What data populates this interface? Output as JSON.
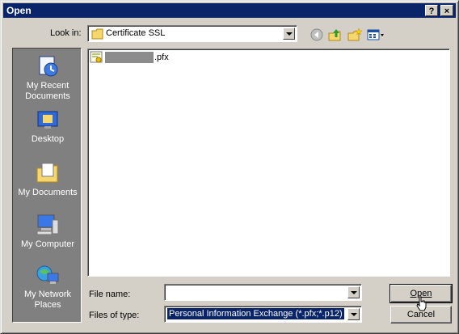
{
  "window": {
    "title": "Open"
  },
  "title_buttons": {
    "help": "?",
    "close": "×"
  },
  "look_in": {
    "label": "Look in:",
    "value": "Certificate SSL"
  },
  "toolbar_icons": [
    "back-icon",
    "up-folder-icon",
    "new-folder-icon",
    "view-menu-icon"
  ],
  "places": [
    {
      "label": "My Recent Documents",
      "icon": "recent-documents-icon"
    },
    {
      "label": "Desktop",
      "icon": "desktop-icon"
    },
    {
      "label": "My Documents",
      "icon": "my-documents-icon"
    },
    {
      "label": "My Computer",
      "icon": "my-computer-icon"
    },
    {
      "label": "My Network Places",
      "icon": "network-places-icon"
    }
  ],
  "files": [
    {
      "name_suffix": ".pfx",
      "icon": "certificate-file-icon"
    }
  ],
  "file_name": {
    "label": "File name:",
    "value": ""
  },
  "files_of_type": {
    "label": "Files of type:",
    "value": "Personal Information Exchange (*.pfx;*.p12)"
  },
  "buttons": {
    "open": "Open",
    "cancel": "Cancel"
  },
  "colors": {
    "titlebar": "#0a246a",
    "places_bg": "#808080",
    "face": "#d4d0c8",
    "selection": "#0a246a"
  }
}
